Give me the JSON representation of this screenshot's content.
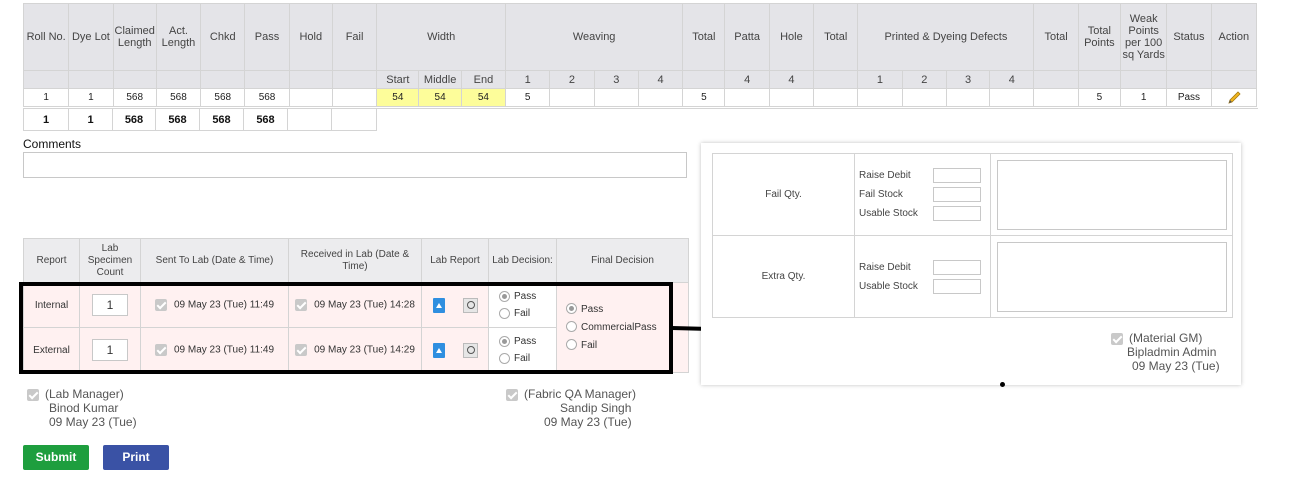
{
  "inspection": {
    "headers": {
      "roll_no": "Roll No.",
      "dye_lot": "Dye Lot",
      "claimed_length": "Claimed Length",
      "act_length": "Act. Length",
      "chkd": "Chkd",
      "pass": "Pass",
      "hold": "Hold",
      "fail": "Fail",
      "width": "Width",
      "weaving": "Weaving",
      "total": "Total",
      "patta": "Patta",
      "hole": "Hole",
      "total2": "Total",
      "printed_dyeing": "Printed & Dyeing Defects",
      "total3": "Total",
      "total_points": "Total Points",
      "weak_points": "Weak Points per 100 sq Yards",
      "status": "Status",
      "action": "Action"
    },
    "subheaders": {
      "width_start": "Start",
      "width_middle": "Middle",
      "width_end": "End",
      "weaving": [
        "1",
        "2",
        "3",
        "4"
      ],
      "patta": "4",
      "hole": "4",
      "printed": [
        "1",
        "2",
        "3",
        "4"
      ]
    },
    "row": {
      "roll_no": "1",
      "dye_lot": "1",
      "claimed_length": "568",
      "act_length": "568",
      "chkd": "568",
      "pass": "568",
      "width_start": "54",
      "width_middle": "54",
      "width_end": "54",
      "weaving_1": "5",
      "total": "5",
      "total_points": "5",
      "weak_points": "1",
      "status": "Pass"
    },
    "totals": {
      "roll_no": "1",
      "dye_lot": "1",
      "claimed_length": "568",
      "act_length": "568",
      "chkd": "568",
      "pass": "568"
    }
  },
  "comments": {
    "label": "Comments",
    "value": ""
  },
  "lab": {
    "headers": {
      "report": "Report",
      "specimen": "Lab Specimen Count",
      "sent": "Sent To Lab (Date & Time)",
      "received": "Received in Lab (Date & Time)",
      "lab_report": "Lab Report",
      "decision": "Lab Decision:",
      "final": "Final Decision"
    },
    "rows": [
      {
        "report": "Internal",
        "specimen": "1",
        "sent": "09 May 23 (Tue) 11:49",
        "received": "09 May 23 (Tue) 14:28",
        "decision_pass": "Pass",
        "decision_fail": "Fail"
      },
      {
        "report": "External",
        "specimen": "1",
        "sent": "09 May 23 (Tue) 11:49",
        "received": "09 May 23 (Tue) 14:29",
        "decision_pass": "Pass",
        "decision_fail": "Fail"
      }
    ],
    "final_options": [
      "Pass",
      "CommercialPass",
      "Fail"
    ]
  },
  "signatures": {
    "lab_manager": {
      "role": "(Lab Manager)",
      "name": "Binod Kumar",
      "date": "09 May 23 (Tue)"
    },
    "fabric_qa": {
      "role": "(Fabric QA Manager)",
      "name": "Sandip Singh",
      "date": "09 May 23 (Tue)"
    },
    "material_gm": {
      "role": "(Material GM)",
      "name": "Bipladmin Admin",
      "date": "09 May 23 (Tue)"
    }
  },
  "buttons": {
    "submit": "Submit",
    "print": "Print"
  },
  "panel": {
    "fail_qty": {
      "label": "Fail Qty.",
      "fields": [
        "Raise Debit",
        "Fail Stock",
        "Usable Stock"
      ]
    },
    "extra_qty": {
      "label": "Extra Qty.",
      "fields": [
        "Raise Debit",
        "Usable Stock"
      ]
    }
  },
  "colors": {
    "submit": "#1e9e3e",
    "print": "#3a52a5",
    "pass_green": "#1d8f1d",
    "width_highlight": "#fdfd9a",
    "lab_row_bg": "#fff1f1"
  },
  "icons": [
    "pencil-icon",
    "upload-icon",
    "view-icon",
    "checkbox-icon",
    "radio-icon"
  ]
}
